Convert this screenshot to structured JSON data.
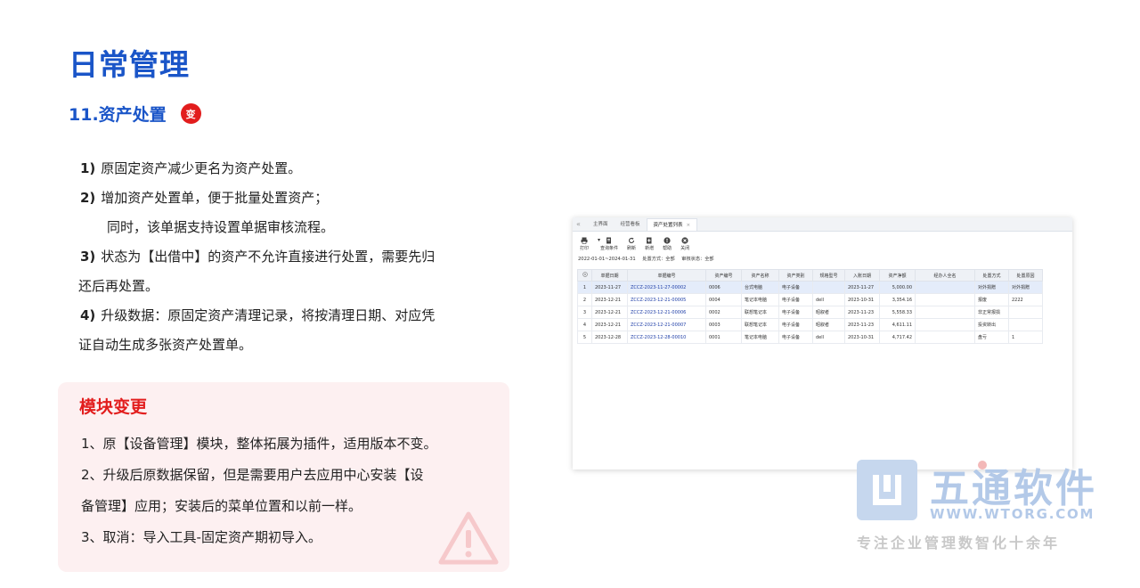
{
  "slide": {
    "title": "日常管理",
    "section_title": "11.资产处置",
    "badge": "变"
  },
  "bullets": [
    {
      "num": "1)",
      "text": "原固定资产减少更名为资产处置。"
    },
    {
      "num": "2)",
      "text": "增加资产处置单，便于批量处置资产；"
    },
    {
      "num": "",
      "text": "同时，该单据支持设置单据审核流程。"
    },
    {
      "num": "3)",
      "text": "状态为【出借中】的资产不允许直接进行处置，需要先归"
    },
    {
      "num": "",
      "text": "还后再处置。"
    },
    {
      "num": "4)",
      "text": "升级数据：原固定资产清理记录，将按清理日期、对应凭"
    },
    {
      "num": "",
      "text": "证自动生成多张资产处置单。"
    }
  ],
  "module": {
    "title": "模块变更",
    "items": [
      "1、原【设备管理】模块，整体拓展为插件，适用版本不变。",
      "2、升级后原数据保留，但是需要用户去应用中心安装【设",
      "备管理】应用；安装后的菜单位置和以前一样。",
      "3、取消：导入工具-固定资产期初导入。"
    ]
  },
  "screenshot": {
    "tabs": [
      {
        "label": "主界面",
        "active": false
      },
      {
        "label": "经营看板",
        "active": false
      },
      {
        "label": "资产处置列表",
        "active": true
      }
    ],
    "tab_close": "×",
    "nav_arrow": "«",
    "toolbar": [
      {
        "label": "打印",
        "icon": "printer-icon"
      },
      {
        "label": "查询条件",
        "icon": "filter-doc-icon"
      },
      {
        "label": "刷新",
        "icon": "refresh-icon"
      },
      {
        "label": "新增",
        "icon": "add-doc-icon"
      },
      {
        "label": "帮助",
        "icon": "help-icon"
      },
      {
        "label": "关闭",
        "icon": "close-icon"
      }
    ],
    "filter": {
      "date_range": "2022-01-01~2024-01-31",
      "method": "处置方式：全部",
      "status": "审核状态：全部"
    },
    "columns": [
      "",
      "单据日期",
      "单据编号",
      "资产编号",
      "资产名称",
      "资产类别",
      "规格型号",
      "入账日期",
      "资产净额",
      "经办人全名",
      "处置方式",
      "处置原因"
    ],
    "rows": [
      [
        "1",
        "2023-11-27",
        "ZCCZ-2023-11-27-00002",
        "0006",
        "台式电脑",
        "电子设备",
        "",
        "2023-11-27",
        "5,000.00",
        "",
        "对外捐赠",
        "对外捐赠"
      ],
      [
        "2",
        "2023-12-21",
        "ZCCZ-2023-12-21-00005",
        "0004",
        "笔记本电脑",
        "电子设备",
        "dell",
        "2023-10-31",
        "3,354.16",
        "",
        "报废",
        "2222"
      ],
      [
        "3",
        "2023-12-21",
        "ZCCZ-2023-12-21-00006",
        "0002",
        "联想笔记本",
        "电子设备",
        "昭叙者",
        "2023-11-23",
        "5,558.33",
        "",
        "非正常报损",
        ""
      ],
      [
        "4",
        "2023-12-21",
        "ZCCZ-2023-12-21-00007",
        "0003",
        "联想笔记本",
        "电子设备",
        "昭叙者",
        "2023-11-23",
        "4,611.11",
        "",
        "投资转出",
        ""
      ],
      [
        "5",
        "2023-12-28",
        "ZCCZ-2023-12-28-00010",
        "0001",
        "笔记本电脑",
        "电子设备",
        "dell",
        "2023-10-31",
        "4,717.42",
        "",
        "盘亏",
        "1"
      ]
    ]
  },
  "logo": {
    "name": "五通软件",
    "url": "WWW.WTORG.COM",
    "slogan": "专注企业管理数智化十余年"
  },
  "colors": {
    "title_blue": "#1a55c8",
    "accent_red": "#e21d1d",
    "module_bg": "#fdf0f1"
  }
}
